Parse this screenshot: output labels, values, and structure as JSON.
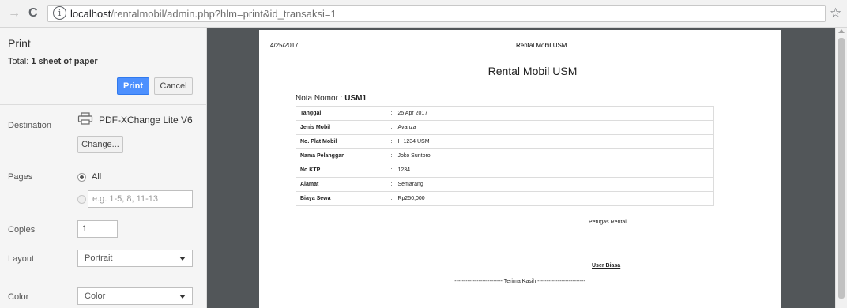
{
  "browser": {
    "url_host": "localhost",
    "url_path": "/rentalmobil/admin.php?hlm=print&id_transaksi=1"
  },
  "print_panel": {
    "title": "Print",
    "total_prefix": "Total: ",
    "total_value": "1 sheet of paper",
    "print_button": "Print",
    "cancel_button": "Cancel",
    "destination_label": "Destination",
    "destination_name": "PDF-XChange Lite V6",
    "change_button": "Change...",
    "pages_label": "Pages",
    "pages_all": "All",
    "pages_placeholder": "e.g. 1-5, 8, 11-13",
    "copies_label": "Copies",
    "copies_value": "1",
    "layout_label": "Layout",
    "layout_value": "Portrait",
    "color_label": "Color",
    "color_value": "Color"
  },
  "document": {
    "header_date": "4/25/2017",
    "header_title": "Rental Mobil USM",
    "title": "Rental Mobil USM",
    "nota_label": "Nota Nomor : ",
    "nota_value": "USM1",
    "rows": [
      {
        "key": "Tanggal",
        "value": "25 Apr 2017"
      },
      {
        "key": "Jenis Mobil",
        "value": "Avanza"
      },
      {
        "key": "No. Plat Mobil",
        "value": "H 1234 USM"
      },
      {
        "key": "Nama Pelanggan",
        "value": "Joko Suntoro"
      },
      {
        "key": "No KTP",
        "value": "1234"
      },
      {
        "key": "Alamat",
        "value": "Semarang"
      },
      {
        "key": "Biaya Sewa",
        "value": "Rp250,000"
      }
    ],
    "petugas": "Petugas Rental",
    "user": "User Biasa",
    "thanks": "-------------------------- Terima Kasih --------------------------"
  }
}
